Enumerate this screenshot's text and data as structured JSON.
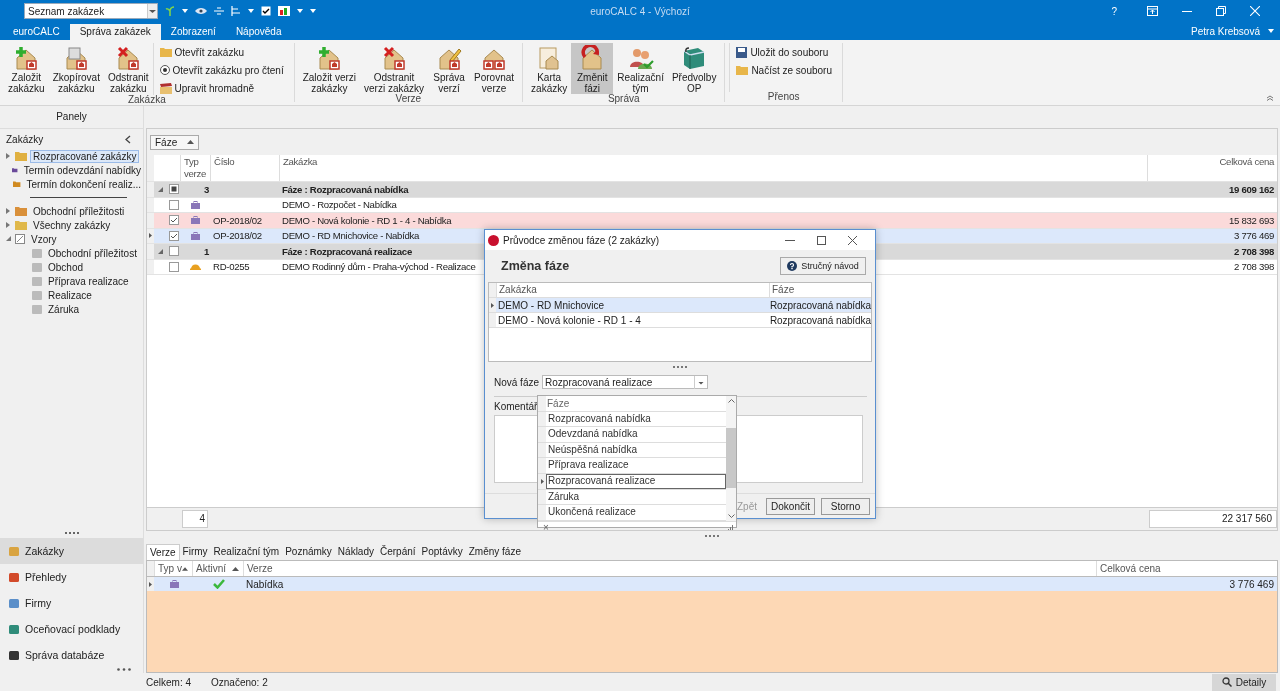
{
  "window": {
    "title": "euroCALC 4 - Výchozí",
    "quick_access": {
      "value": "Seznam zakázek"
    },
    "help": "?",
    "user": "Petra Krebsová"
  },
  "ribbon_tabs": [
    {
      "label": "euroCALC",
      "selected": false
    },
    {
      "label": "Správa zakázek",
      "selected": true
    },
    {
      "label": "Zobrazení",
      "selected": false
    },
    {
      "label": "Nápověda",
      "selected": false
    }
  ],
  "ribbon_groups": [
    {
      "label": "Zakázka",
      "items": [
        {
          "kind": "large",
          "lines": [
            "Založit",
            "zakázku"
          ],
          "pressed": false
        },
        {
          "kind": "large",
          "lines": [
            "Zkopírovat",
            "zakázku"
          ],
          "pressed": false
        },
        {
          "kind": "large",
          "lines": [
            "Odstranit",
            "zakázku"
          ],
          "pressed": false
        },
        {
          "kind": "stack",
          "buttons": [
            "Otevřít zakázku",
            "Otevřít zakázku pro čtení",
            "Upravit hromadně"
          ]
        }
      ]
    },
    {
      "label": "Verze",
      "items": [
        {
          "kind": "large",
          "lines": [
            "Založit verzi",
            "zakázky"
          ],
          "pressed": false
        },
        {
          "kind": "large",
          "lines": [
            "Odstranit",
            "verzi zakázky"
          ],
          "pressed": false
        },
        {
          "kind": "large",
          "lines": [
            "Správa",
            "verzí"
          ],
          "pressed": false
        },
        {
          "kind": "large",
          "lines": [
            "Porovnat",
            "verze"
          ],
          "pressed": false
        }
      ]
    },
    {
      "label": "Správa",
      "items": [
        {
          "kind": "large",
          "lines": [
            "Karta",
            "zakázky"
          ],
          "pressed": false
        },
        {
          "kind": "large",
          "lines": [
            "Změnit",
            "fázi"
          ],
          "pressed": true
        },
        {
          "kind": "large",
          "lines": [
            "Realizační",
            "tým"
          ],
          "pressed": false
        },
        {
          "kind": "large",
          "lines": [
            "Předvolby",
            "OP"
          ],
          "pressed": false
        }
      ]
    },
    {
      "label": "Přenos",
      "items": [
        {
          "kind": "stack",
          "buttons": [
            "Uložit do souboru",
            "Načíst ze souboru"
          ]
        }
      ]
    }
  ],
  "panels": {
    "title": "Panely",
    "section": "Zakázky",
    "favorites": [
      {
        "label": "Rozpracované zakázky",
        "selected": true,
        "expanded": false
      },
      {
        "label": "Termín odevzdání nabídky",
        "selected": false
      },
      {
        "label": "Termín dokončení realiz...",
        "selected": false
      }
    ],
    "tree": [
      {
        "label": "Obchodní příležitosti",
        "selected": false,
        "expanded": false
      },
      {
        "label": "Všechny zakázky",
        "selected": false,
        "expanded": false
      },
      {
        "label": "Vzory",
        "selected": false,
        "expanded": true,
        "children": [
          {
            "label": "Obchodní příležitost",
            "selected": false
          },
          {
            "label": "Obchod",
            "selected": false
          },
          {
            "label": "Příprava realizace",
            "selected": false
          },
          {
            "label": "Realizace",
            "selected": false
          },
          {
            "label": "Záruka",
            "selected": false
          }
        ]
      }
    ],
    "nav": [
      {
        "label": "Zakázky",
        "selected": true
      },
      {
        "label": "Přehledy",
        "selected": false
      },
      {
        "label": "Firmy",
        "selected": false
      },
      {
        "label": "Oceňovací podklady",
        "selected": false
      },
      {
        "label": "Správa databáze",
        "selected": false
      }
    ]
  },
  "table": {
    "group_by": "Fáze",
    "columns": [
      "Typ verze",
      "Číslo",
      "Zakázka",
      "Celková cena"
    ],
    "rows": [
      {
        "kind": "group",
        "expanded": true,
        "partially_checked": true,
        "count": "3",
        "label": "Fáze : Rozpracovaná nabídka",
        "total": "19 609 162"
      },
      {
        "kind": "offer",
        "checked": false,
        "selected": false,
        "highlighted": false,
        "name": "DEMO - Rozpočet - Nabídka"
      },
      {
        "kind": "offer",
        "checked": true,
        "selected": false,
        "highlighted": true,
        "number": "OP-2018/02",
        "name": "DEMO - Nová kolonie - RD 1 - 4 - Nabídka",
        "price": "15 832 693"
      },
      {
        "kind": "offer",
        "checked": true,
        "selected": true,
        "highlighted": false,
        "number": "OP-2018/02",
        "name": "DEMO - RD Mnichovice - Nabídka",
        "price": "3 776 469"
      },
      {
        "kind": "group",
        "expanded": true,
        "partially_checked": false,
        "count": "1",
        "label": "Fáze : Rozpracovaná realizace",
        "total": "2 708 398"
      },
      {
        "kind": "realization",
        "checked": false,
        "selected": false,
        "highlighted": false,
        "number": "RD-0255",
        "name": "DEMO Rodinný dům - Praha-východ - Realizace",
        "price": "2 708 398"
      }
    ],
    "footer_count": "4",
    "footer_total": "22 317 560"
  },
  "detail": {
    "tabs": [
      {
        "label": "Verze",
        "selected": true
      },
      {
        "label": "Firmy",
        "selected": false
      },
      {
        "label": "Realizační tým",
        "selected": false
      },
      {
        "label": "Poznámky",
        "selected": false
      },
      {
        "label": "Náklady",
        "selected": false
      },
      {
        "label": "Čerpání",
        "selected": false
      },
      {
        "label": "Poptávky",
        "selected": false
      },
      {
        "label": "Změny fáze",
        "selected": false
      }
    ],
    "columns": [
      "Typ v",
      "Aktivní",
      "Verze",
      "Celková cena"
    ],
    "rows": [
      {
        "kind": "offer",
        "active": true,
        "selected": true,
        "name": "Nabídka",
        "price": "3 776 469"
      }
    ]
  },
  "status_bar": {
    "total": "Celkem: 4",
    "marked": "Označeno: 2",
    "details_button": "Detaily"
  },
  "dialog": {
    "title": "Průvodce změnou fáze (2 zakázky)",
    "heading": "Změna fáze",
    "help_button": "Stručný návod",
    "columns": [
      "Zakázka",
      "Fáze"
    ],
    "rows": [
      {
        "order": "DEMO - RD Mnichovice",
        "phase": "Rozpracovaná nabídka",
        "selected": true
      },
      {
        "order": "DEMO - Nová kolonie - RD 1 - 4",
        "phase": "Rozpracovaná nabídka",
        "selected": false
      }
    ],
    "new_phase_label": "Nová fáze",
    "new_phase": {
      "value": "Rozpracovaná realizace"
    },
    "comment_label": "Komentář",
    "buttons": [
      {
        "label": "Zpět",
        "disabled": true
      },
      {
        "label": "Dokončit",
        "disabled": false
      },
      {
        "label": "Storno",
        "disabled": false
      }
    ],
    "dropdown": {
      "header": "Fáze",
      "clear": "×",
      "options": [
        {
          "label": "Rozpracovaná nabídka",
          "selected": false
        },
        {
          "label": "Odevzdaná nabídka",
          "selected": false
        },
        {
          "label": "Neúspěšná nabídka",
          "selected": false
        },
        {
          "label": "Příprava realizace",
          "selected": false
        },
        {
          "label": "Rozpracovaná realizace",
          "selected": true
        },
        {
          "label": "Záruka",
          "selected": false
        },
        {
          "label": "Ukončená realizace",
          "selected": false
        }
      ]
    }
  }
}
